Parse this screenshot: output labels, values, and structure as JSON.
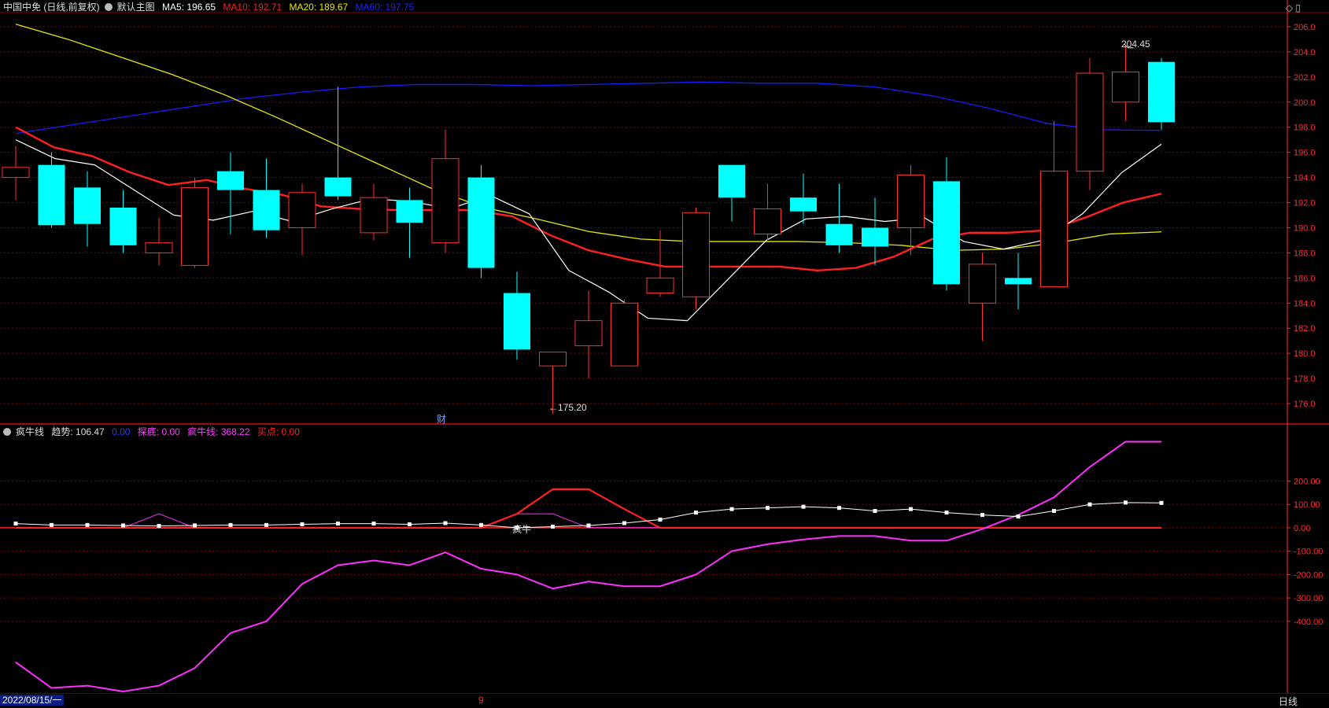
{
  "header": {
    "title": "中国中免 (日线,前复权)",
    "template": "默认主图",
    "ma": [
      {
        "label": "MA5: 196.65",
        "color": "#ffffff"
      },
      {
        "label": "MA10: 192.71",
        "color": "#ff2020"
      },
      {
        "label": "MA20: 189.67",
        "color": "#e8e800"
      },
      {
        "label": "MA60: 197.75",
        "color": "#2020ff"
      }
    ]
  },
  "indicator_header": {
    "name": "疯牛线",
    "items": [
      {
        "label": "趋势: 106.47",
        "color": "#dddddd"
      },
      {
        "label": "0.00",
        "color": "#2040ff"
      },
      {
        "label": "探底: 0.00",
        "color": "#ff40ff"
      },
      {
        "label": "疯牛线: 368.22",
        "color": "#ff40ff"
      },
      {
        "label": "买点: 0.00",
        "color": "#ff2020"
      }
    ]
  },
  "annotations": {
    "high": "204.45",
    "low": "←175.20",
    "fin": "财",
    "bull": "疯牛"
  },
  "footer": {
    "date": "2022/08/15/一",
    "marker": "9",
    "period": "日线"
  },
  "colors": {
    "up": "#ff3030",
    "down": "#00ffff",
    "grid": "#8b0000",
    "axis": "#ff2a2a",
    "ma5": "#ffffff",
    "ma10": "#ff2020",
    "ma20": "#e8e800",
    "ma60": "#1a1aff",
    "trend": "#ffffff",
    "bull": "#ff30ff",
    "buy": "#ff2020",
    "tandi": "#ff30ff",
    "base": "#ff2020"
  },
  "chart_data": [
    {
      "type": "candlestick",
      "title": "中国中免 (日线,前复权)",
      "ylim": [
        174.5,
        207
      ],
      "yticks": [
        176,
        178,
        180,
        182,
        184,
        186,
        188,
        190,
        192,
        194,
        196,
        198,
        200,
        202,
        204,
        206
      ],
      "ytick_labels": [
        "176.0",
        "178.0",
        "180.0",
        "182.0",
        "184.0",
        "186.0",
        "188.0",
        "190.0",
        "192.0",
        "194.0",
        "196.0",
        "198.0",
        "200.0",
        "202.0",
        "204.0",
        "206.0"
      ],
      "candles": [
        {
          "o": 194.0,
          "c": 194.8,
          "h": 196.5,
          "l": 192.2
        },
        {
          "o": 195.0,
          "c": 190.2,
          "h": 196.0,
          "l": 190.0
        },
        {
          "o": 193.2,
          "c": 190.3,
          "h": 194.5,
          "l": 188.5
        },
        {
          "o": 191.6,
          "c": 188.6,
          "h": 193.0,
          "l": 188.0
        },
        {
          "o": 188.0,
          "c": 188.8,
          "h": 190.8,
          "l": 187.0
        },
        {
          "o": 187.0,
          "c": 193.2,
          "h": 194.0,
          "l": 186.8
        },
        {
          "o": 194.5,
          "c": 193.0,
          "h": 196.0,
          "l": 189.5
        },
        {
          "o": 193.0,
          "c": 189.8,
          "h": 195.5,
          "l": 189.2
        },
        {
          "o": 190.0,
          "c": 192.8,
          "h": 193.5,
          "l": 187.8
        },
        {
          "o": 194.0,
          "c": 192.5,
          "h": 201.2,
          "l": 192.2
        },
        {
          "o": 189.6,
          "c": 192.4,
          "h": 193.5,
          "l": 189.0
        },
        {
          "o": 192.2,
          "c": 190.4,
          "h": 193.2,
          "l": 187.6
        },
        {
          "o": 188.8,
          "c": 195.5,
          "h": 197.8,
          "l": 188.0
        },
        {
          "o": 194.0,
          "c": 186.8,
          "h": 195.0,
          "l": 186.0
        },
        {
          "o": 184.8,
          "c": 180.3,
          "h": 186.5,
          "l": 179.5
        },
        {
          "o": 179.0,
          "c": 180.1,
          "h": 180.1,
          "l": 175.2
        },
        {
          "o": 180.6,
          "c": 182.6,
          "h": 185.0,
          "l": 178.0
        },
        {
          "o": 179.0,
          "c": 184.0,
          "h": 184.3,
          "l": 179.0
        },
        {
          "o": 184.8,
          "c": 186.0,
          "h": 189.8,
          "l": 184.5
        },
        {
          "o": 184.5,
          "c": 191.2,
          "h": 191.6,
          "l": 183.5
        },
        {
          "o": 195.0,
          "c": 192.4,
          "h": 195.0,
          "l": 190.5
        },
        {
          "o": 189.5,
          "c": 191.5,
          "h": 193.5,
          "l": 189.0
        },
        {
          "o": 192.4,
          "c": 191.3,
          "h": 194.3,
          "l": 190.3
        },
        {
          "o": 190.3,
          "c": 188.6,
          "h": 193.5,
          "l": 188.0
        },
        {
          "o": 190.0,
          "c": 188.5,
          "h": 192.4,
          "l": 187.0
        },
        {
          "o": 190.0,
          "c": 194.2,
          "h": 195.0,
          "l": 187.8
        },
        {
          "o": 193.7,
          "c": 185.5,
          "h": 195.6,
          "l": 185.0
        },
        {
          "o": 184.0,
          "c": 187.1,
          "h": 188.0,
          "l": 181.0
        },
        {
          "o": 186.0,
          "c": 185.5,
          "h": 188.0,
          "l": 183.5
        },
        {
          "o": 185.3,
          "c": 194.5,
          "h": 198.5,
          "l": 185.3
        },
        {
          "o": 194.5,
          "c": 202.3,
          "h": 203.5,
          "l": 193.0
        },
        {
          "o": 200.0,
          "c": 202.4,
          "h": 204.45,
          "l": 198.5
        },
        {
          "o": 203.2,
          "c": 198.4,
          "h": 203.5,
          "l": 197.8
        }
      ],
      "ma5": [
        197.0,
        195.5,
        195.0,
        193.0,
        191.0,
        190.6,
        191.3,
        190.5,
        191.5,
        192.3,
        192.1,
        191.5,
        192.6,
        191.1,
        186.6,
        184.9,
        182.8,
        182.6,
        185.8,
        189.0,
        190.7,
        190.9,
        190.5,
        190.8,
        188.9,
        188.3,
        189.0,
        191.1,
        194.4,
        196.65
      ],
      "ma5_start": 0,
      "ma10": [
        198.0,
        196.4,
        195.7,
        194.4,
        193.4,
        193.8,
        193.1,
        192.6,
        191.7,
        191.5,
        191.4,
        191.4,
        191.4,
        190.9,
        189.4,
        188.2,
        187.5,
        186.9,
        186.9,
        186.9,
        186.9,
        186.6,
        186.8,
        187.7,
        189.1,
        189.6,
        189.6,
        189.8,
        190.8,
        192.0,
        192.71
      ],
      "ma10_start": 0,
      "ma20": [
        206.2,
        205.0,
        203.6,
        202.2,
        200.6,
        198.8,
        196.9,
        195.0,
        193.1,
        191.6,
        190.7,
        189.7,
        189.1,
        188.9,
        188.9,
        188.9,
        188.8,
        188.6,
        188.2,
        188.3,
        188.8,
        189.5,
        189.67
      ],
      "ma20_indices": [
        0,
        1,
        2,
        3,
        4,
        5,
        6,
        7,
        8,
        9,
        10,
        11,
        12,
        13,
        14,
        15,
        16,
        17,
        18,
        19,
        20,
        21,
        22
      ],
      "ma60": [
        197.5,
        198.2,
        198.9,
        199.6,
        200.3,
        200.8,
        201.2,
        201.4,
        201.4,
        201.3,
        201.4,
        201.5,
        201.6,
        201.5,
        201.5,
        201.2,
        200.5,
        199.5,
        198.3,
        197.8,
        197.75
      ]
    },
    {
      "type": "line",
      "title": "疯牛线",
      "ylim": [
        -700,
        390
      ],
      "yticks": [
        200,
        100,
        0,
        -100,
        -200,
        -300,
        -400
      ],
      "ytick_labels": [
        "200.00",
        "100.00",
        "0.00",
        "-100.00",
        "-200.00",
        "-300.00",
        "-400.00"
      ],
      "series": [
        {
          "name": "趋势",
          "values": [
            18,
            12,
            12,
            10,
            8,
            10,
            12,
            12,
            15,
            18,
            18,
            15,
            20,
            12,
            0,
            5,
            10,
            20,
            35,
            65,
            80,
            85,
            90,
            85,
            72,
            80,
            65,
            55,
            48,
            72,
            100,
            108,
            106.47
          ]
        },
        {
          "name": "疯牛线",
          "values": [
            -575,
            -685,
            -675,
            -700,
            -675,
            -600,
            -450,
            -400,
            -240,
            -160,
            -140,
            -160,
            -105,
            -175,
            -200,
            -260,
            -230,
            -250,
            -250,
            -200,
            -100,
            -70,
            -50,
            -35,
            -35,
            -55,
            -55,
            -5,
            55,
            130,
            260,
            368.22,
            368.22
          ]
        },
        {
          "name": "买点",
          "values": [
            0,
            0,
            0,
            0,
            0,
            0,
            0,
            0,
            0,
            0,
            0,
            0,
            0,
            0,
            60,
            165,
            165,
            80,
            0,
            0,
            0,
            0,
            0,
            0,
            0,
            0,
            0,
            0,
            0,
            0,
            0,
            0,
            0
          ]
        },
        {
          "name": "探底",
          "values": [
            0,
            0,
            0,
            0,
            60,
            0,
            0,
            0,
            0,
            0,
            0,
            0,
            0,
            0,
            60,
            60,
            0,
            0,
            0,
            0,
            0,
            0,
            0,
            0,
            0,
            0,
            0,
            0,
            0,
            0,
            0,
            0,
            0
          ]
        }
      ]
    }
  ]
}
